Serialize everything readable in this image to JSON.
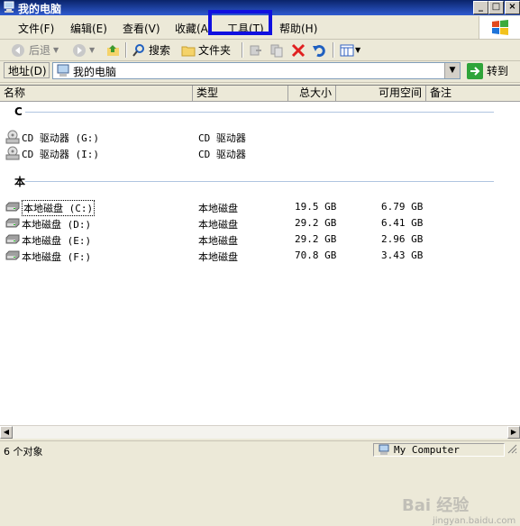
{
  "window": {
    "title": "我的电脑",
    "minimize": "_",
    "maximize": "□",
    "close": "×"
  },
  "menu": {
    "items": [
      {
        "label": "文件(F)"
      },
      {
        "label": "编辑(E)"
      },
      {
        "label": "查看(V)"
      },
      {
        "label": "收藏(A)"
      },
      {
        "label": "工具(T)"
      },
      {
        "label": "帮助(H)"
      }
    ],
    "highlighted": "工具(T)"
  },
  "toolbar": {
    "back": "后退",
    "search": "搜索",
    "folders": "文件夹"
  },
  "address": {
    "label": "地址(D)",
    "value": "我的电脑",
    "go_label": "转到"
  },
  "columns": [
    "名称",
    "类型",
    "总大小",
    "可用空间",
    "备注"
  ],
  "groups": [
    {
      "label": "C",
      "items": [
        {
          "name": "CD 驱动器 (G:)",
          "type": "CD 驱动器",
          "total": "",
          "free": ""
        },
        {
          "name": "CD 驱动器 (I:)",
          "type": "CD 驱动器",
          "total": "",
          "free": ""
        }
      ]
    },
    {
      "label": "本",
      "items": [
        {
          "name": "本地磁盘 (C:)",
          "type": "本地磁盘",
          "total": "19.5 GB",
          "free": "6.79 GB"
        },
        {
          "name": "本地磁盘 (D:)",
          "type": "本地磁盘",
          "total": "29.2 GB",
          "free": "6.41 GB"
        },
        {
          "name": "本地磁盘 (E:)",
          "type": "本地磁盘",
          "total": "29.2 GB",
          "free": "2.96 GB"
        },
        {
          "name": "本地磁盘 (F:)",
          "type": "本地磁盘",
          "total": "70.8 GB",
          "free": "3.43 GB"
        }
      ]
    }
  ],
  "status": {
    "count": "6 个对象",
    "location": "My Computer"
  },
  "watermark": {
    "text": "Bai 经验",
    "sub": "jingyan.baidu.com"
  },
  "colors": {
    "title_bar": "#0a246a",
    "highlight_box": "#1010e0",
    "window_bg": "#ece9d8"
  }
}
